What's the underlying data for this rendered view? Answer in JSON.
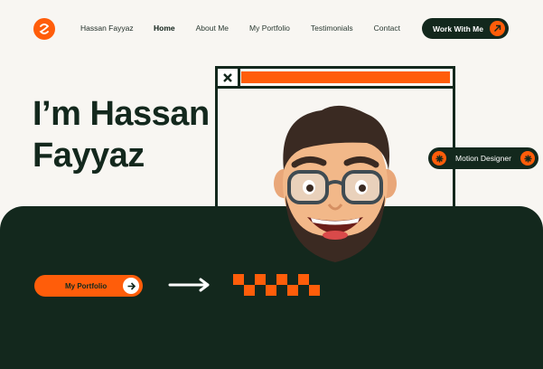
{
  "header": {
    "brand": "Hassan Fayyaz",
    "nav": [
      {
        "label": "Home",
        "active": true
      },
      {
        "label": "About Me",
        "active": false
      },
      {
        "label": "My Portfolio",
        "active": false
      },
      {
        "label": "Testimonials",
        "active": false
      },
      {
        "label": "Contact",
        "active": false
      }
    ],
    "cta_label": "Work With Me"
  },
  "hero": {
    "title_line1": "I’m Hassan",
    "title_line2": "Fayyaz",
    "badge_label": "Motion Designer",
    "portfolio_button": "My Portfolio"
  },
  "colors": {
    "accent": "#ff5d0a",
    "dark": "#13281d",
    "background": "#f8f6f2"
  },
  "icons": {
    "logo": "swirl-logo-icon",
    "cta": "arrow-up-right-icon",
    "badge": "asterisk-icon",
    "portfolio": "arrow-right-icon",
    "window": "close-icon"
  }
}
